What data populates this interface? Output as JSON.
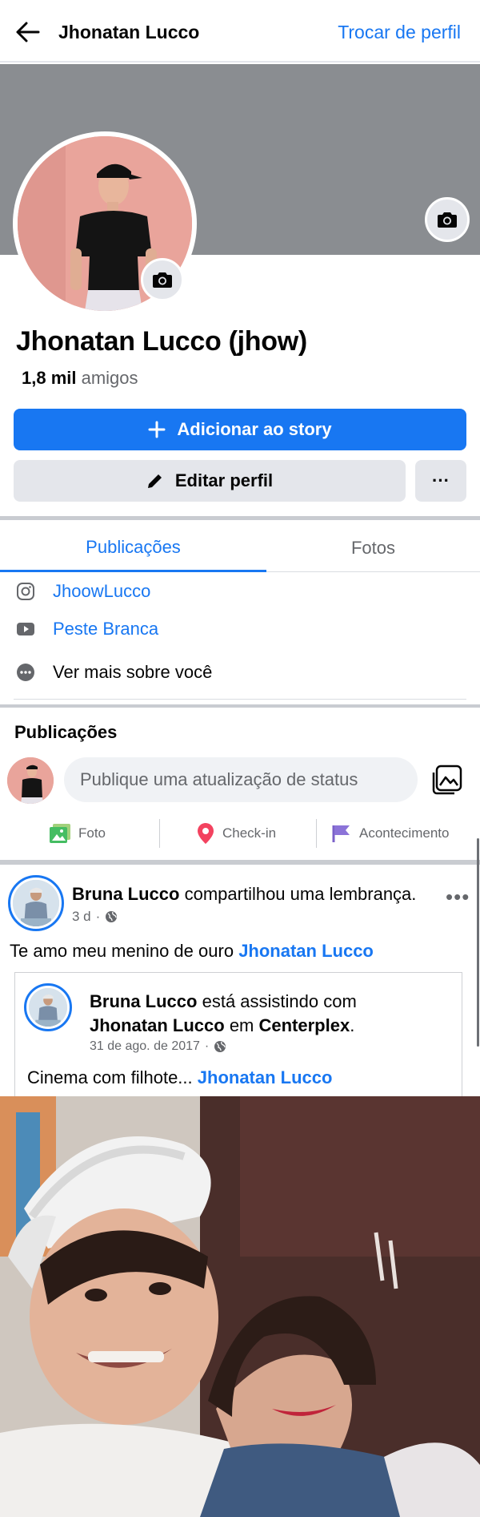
{
  "header": {
    "title": "Jhonatan Lucco",
    "switch_profile": "Trocar de perfil"
  },
  "profile": {
    "name": "Jhonatan Lucco (jhow)",
    "friends_count": "1,8 mil",
    "friends_label": "amigos",
    "add_story": "Adicionar ao story",
    "edit_profile": "Editar perfil",
    "more": "···"
  },
  "tabs": [
    {
      "label": "Publicações",
      "active": true
    },
    {
      "label": "Fotos",
      "active": false
    }
  ],
  "links": {
    "instagram": "JhoowLucco",
    "youtube": "Peste Branca",
    "more_about": "Ver mais sobre você"
  },
  "publications": {
    "title": "Publicações",
    "composer_placeholder": "Publique uma atualização de status",
    "actions": [
      "Foto",
      "Check-in",
      "Acontecimento"
    ]
  },
  "post": {
    "author": "Bruna Lucco",
    "action": "compartilhou uma lembrança.",
    "time": "3 d",
    "text": "Te amo meu menino de ouro",
    "tagged": "Jhonatan Lucco",
    "shared": {
      "author": "Bruna Lucco",
      "action": "está assistindo  com",
      "with": "Jhonatan Lucco",
      "at_word": "em",
      "place": "Centerplex",
      "date": "31 de ago. de 2017",
      "caption": "Cinema com filhote...",
      "caption_tag": "Jhonatan Lucco"
    }
  },
  "colors": {
    "accent": "#1877f2",
    "muted": "#65676b",
    "button_grey": "#e4e6eb",
    "cover": "#8a8d91"
  }
}
